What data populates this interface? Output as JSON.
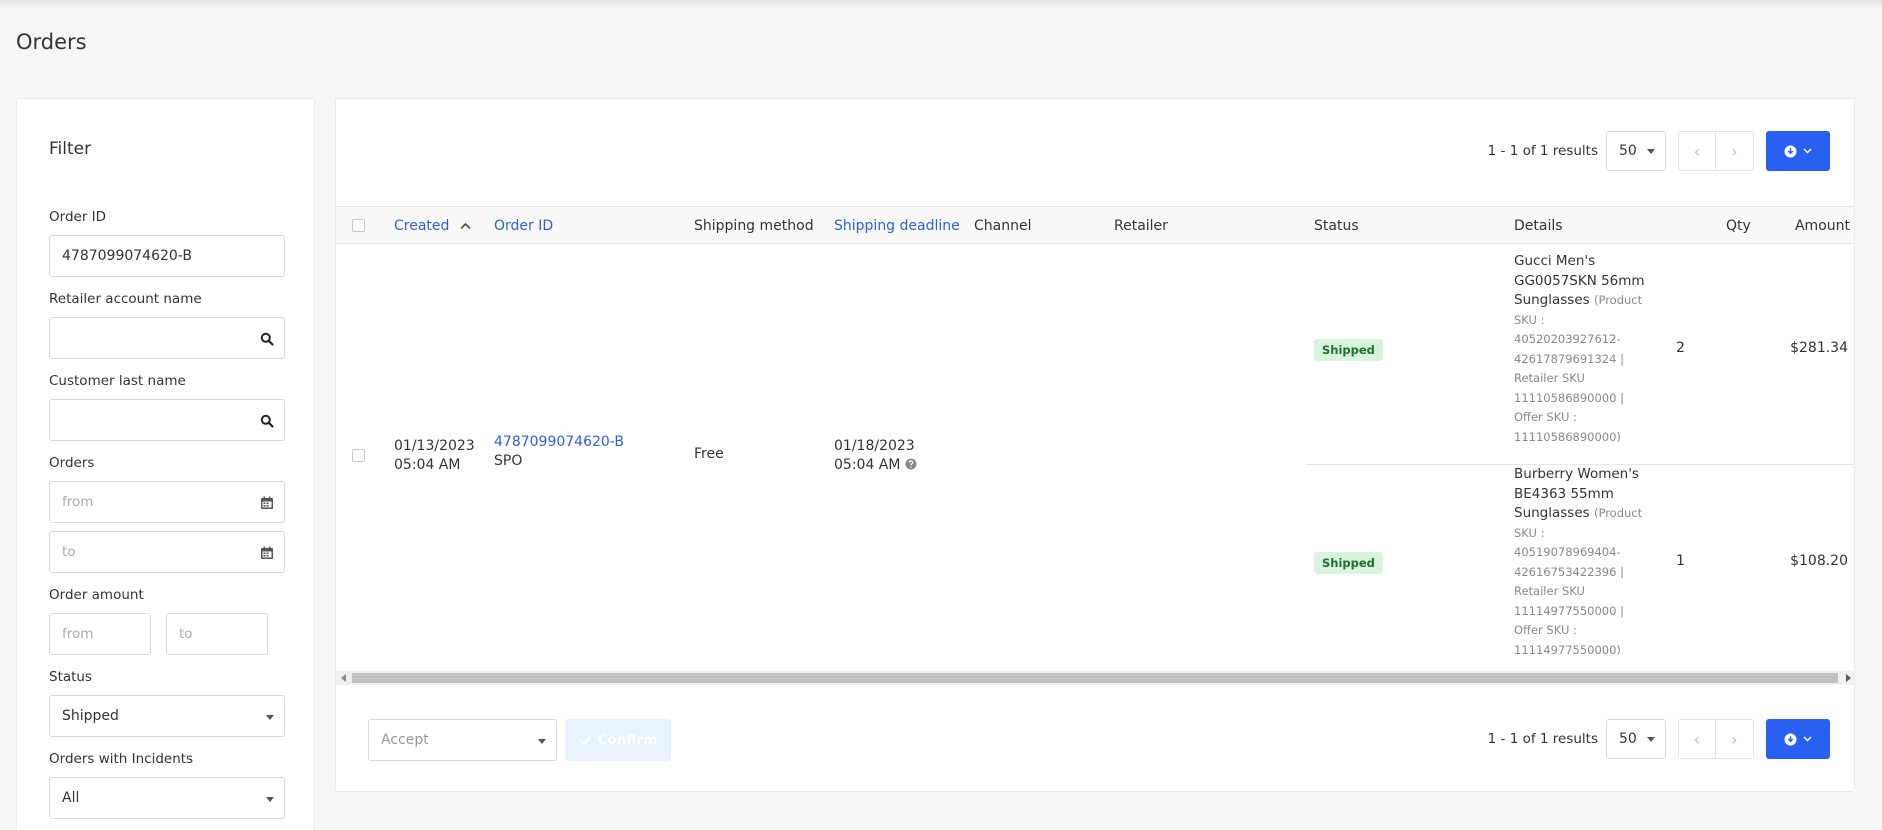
{
  "page": {
    "title": "Orders"
  },
  "filter": {
    "title": "Filter",
    "order_id": {
      "label": "Order ID",
      "value": "4787099074620-B"
    },
    "retailer_account_name": {
      "label": "Retailer account name",
      "value": ""
    },
    "customer_last_name": {
      "label": "Customer last name",
      "value": ""
    },
    "orders": {
      "label": "Orders",
      "from_placeholder": "from",
      "to_placeholder": "to"
    },
    "order_amount": {
      "label": "Order amount",
      "from_placeholder": "from",
      "to_placeholder": "to"
    },
    "status": {
      "label": "Status",
      "value": "Shipped"
    },
    "incidents": {
      "label": "Orders with Incidents",
      "value": "All"
    }
  },
  "pagination": {
    "results": "1 - 1 of 1 results",
    "page_size": "50"
  },
  "table": {
    "columns": {
      "created": "Created",
      "order_id": "Order ID",
      "shipping_method": "Shipping method",
      "shipping_deadline": "Shipping deadline",
      "channel": "Channel",
      "retailer": "Retailer",
      "status": "Status",
      "details": "Details",
      "qty": "Qty",
      "amount": "Amount"
    },
    "order": {
      "created_date": "01/13/2023",
      "created_time": "05:04 AM",
      "order_id": "4787099074620-B",
      "order_type": "SPO",
      "shipping_method": "Free",
      "deadline_date": "01/18/2023",
      "deadline_time": "05:04 AM",
      "lines": [
        {
          "status": "Shipped",
          "product": "Gucci Men's GG0057SKN 56mm Sunglasses",
          "sku": "(Product SKU : 40520203927612-42617879691324 | Retailer SKU 11110586890000 | Offer SKU : 11110586890000)",
          "qty": "2",
          "amount": "$281.34"
        },
        {
          "status": "Shipped",
          "product": "Burberry Women's BE4363 55mm Sunglasses",
          "sku": "(Product SKU : 40519078969404-42616753422396 | Retailer SKU 11114977550000 | Offer SKU : 11114977550000)",
          "qty": "1",
          "amount": "$108.20"
        }
      ]
    }
  },
  "bulk": {
    "action_value": "Accept",
    "confirm_label": "Confirm"
  },
  "colors": {
    "primary": "#2861f1",
    "link": "#2f5fe0",
    "badge_bg": "#d8f3dc",
    "badge_text": "#1f6e32"
  }
}
